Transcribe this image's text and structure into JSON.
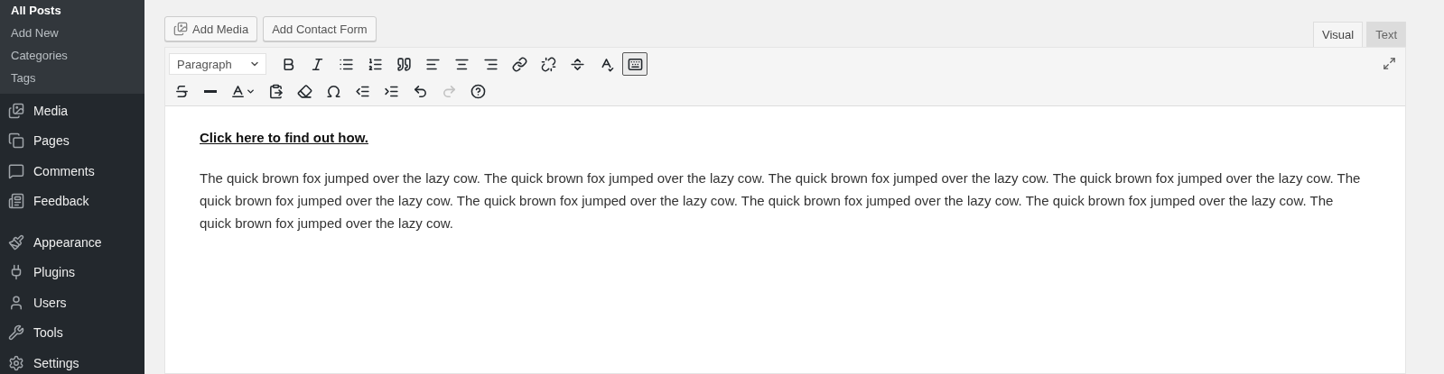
{
  "sidebar": {
    "submenu": [
      {
        "label": "All Posts",
        "selected": true
      },
      {
        "label": "Add New",
        "selected": false
      },
      {
        "label": "Categories",
        "selected": false
      },
      {
        "label": "Tags",
        "selected": false
      }
    ],
    "menu_groups": [
      [
        {
          "label": "Media",
          "kind": "media"
        },
        {
          "label": "Pages",
          "kind": "pages"
        },
        {
          "label": "Comments",
          "kind": "comments"
        },
        {
          "label": "Feedback",
          "kind": "feedback"
        }
      ],
      [
        {
          "label": "Appearance",
          "kind": "appearance"
        },
        {
          "label": "Plugins",
          "kind": "plugins"
        },
        {
          "label": "Users",
          "kind": "users"
        },
        {
          "label": "Tools",
          "kind": "tools"
        },
        {
          "label": "Settings",
          "kind": "settings"
        }
      ]
    ]
  },
  "media_buttons": [
    {
      "label": "Add Media",
      "kind": "media"
    },
    {
      "label": "Add Contact Form",
      "kind": "plain"
    }
  ],
  "editor_tabs": [
    {
      "label": "Visual",
      "selected": true
    },
    {
      "label": "Text",
      "selected": false
    }
  ],
  "toolbar": {
    "format_select": {
      "value": "Paragraph"
    },
    "rows": [
      [
        {
          "kind": "bold",
          "disabled": false,
          "selected": false
        },
        {
          "kind": "italic",
          "disabled": false,
          "selected": false
        },
        {
          "kind": "bullet-list",
          "disabled": false,
          "selected": false
        },
        {
          "kind": "numbered-list",
          "disabled": false,
          "selected": false
        },
        {
          "kind": "quote",
          "disabled": false,
          "selected": false
        },
        {
          "kind": "align-left",
          "disabled": false,
          "selected": false
        },
        {
          "kind": "align-center",
          "disabled": false,
          "selected": false
        },
        {
          "kind": "align-right",
          "disabled": false,
          "selected": false
        },
        {
          "kind": "link",
          "disabled": false,
          "selected": false
        },
        {
          "kind": "unlink",
          "disabled": false,
          "selected": false
        },
        {
          "kind": "read-more",
          "disabled": false,
          "selected": false
        },
        {
          "kind": "spellcheck",
          "disabled": false,
          "selected": false
        },
        {
          "kind": "toolbar-toggle",
          "disabled": false,
          "selected": true
        }
      ],
      [
        {
          "kind": "strikethrough",
          "disabled": false,
          "selected": false
        },
        {
          "kind": "horizontal-line",
          "disabled": false,
          "selected": false
        },
        {
          "kind": "text-color",
          "disabled": false,
          "selected": false
        },
        {
          "kind": "paste-text",
          "disabled": false,
          "selected": false
        },
        {
          "kind": "clear-format",
          "disabled": false,
          "selected": false
        },
        {
          "kind": "special-char",
          "disabled": false,
          "selected": false
        },
        {
          "kind": "outdent",
          "disabled": false,
          "selected": false
        },
        {
          "kind": "indent",
          "disabled": false,
          "selected": false
        },
        {
          "kind": "undo",
          "disabled": false,
          "selected": false
        },
        {
          "kind": "redo",
          "disabled": true,
          "selected": false
        },
        {
          "kind": "help",
          "disabled": false,
          "selected": false
        }
      ]
    ]
  },
  "content": {
    "link": "Click here to find out how.",
    "paragraph": "The quick brown fox jumped over the lazy cow. The quick brown fox jumped over the lazy cow. The quick brown fox jumped over the lazy cow. The quick brown fox jumped over the lazy cow. The quick brown fox jumped over the lazy cow. The quick brown fox jumped over the lazy cow. The quick brown fox jumped over the lazy cow. The quick brown fox jumped over the lazy cow. The quick brown fox jumped over the lazy cow."
  }
}
